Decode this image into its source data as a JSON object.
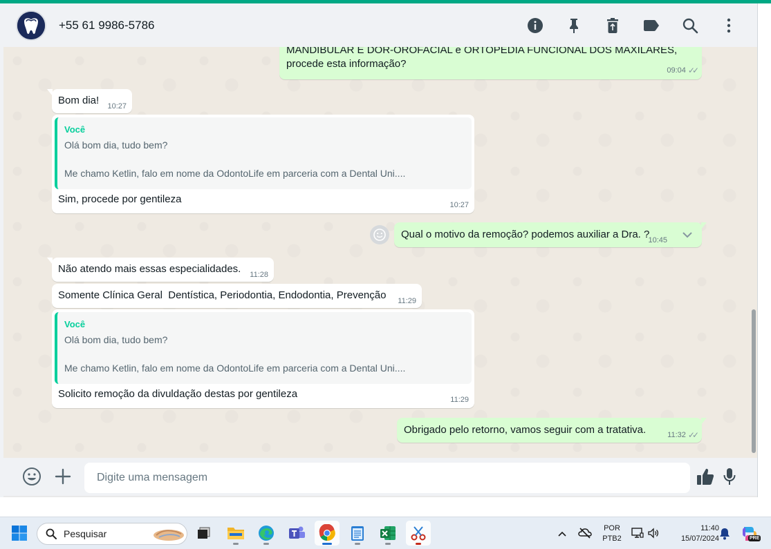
{
  "header": {
    "contact_name": "+55 61 9986-5786",
    "icons": [
      "info-icon",
      "pin-icon",
      "delete-icon",
      "label-icon",
      "search-icon",
      "menu-icon"
    ]
  },
  "messages": [
    {
      "direction": "out",
      "text_line1": "MANDIBULAR E DOR-OROFACIAL e ORTOPEDIA FUNCIONAL DOS MAXILARES,",
      "text_line2": "procede esta informação?",
      "time": "09:04",
      "status": "read"
    },
    {
      "direction": "in",
      "text": "Bom dia!",
      "time": "10:27"
    },
    {
      "direction": "in",
      "quote_author": "Você",
      "quote_line1": "Olá bom dia, tudo bem?",
      "quote_line2": "Me chamo Ketlin, falo em nome da OdontoLife em parceria com a Dental Uni....",
      "text": "Sim, procede por gentileza",
      "time": "10:27"
    },
    {
      "direction": "out",
      "text": "Qual o motivo da remoção? podemos auxiliar a Dra. ?",
      "time": "10:45",
      "status": "read"
    },
    {
      "direction": "in",
      "text": "Não atendo mais essas especialidades.",
      "time": "11:28"
    },
    {
      "direction": "in",
      "text": "Somente Clínica Geral  Dentística, Periodontia, Endodontia, Prevenção",
      "time": "11:29"
    },
    {
      "direction": "in",
      "quote_author": "Você",
      "quote_line1": "Olá bom dia, tudo bem?",
      "quote_line2": "Me chamo Ketlin, falo em nome da OdontoLife em parceria com a Dental Uni....",
      "text": "Solicito remoção da divuldação destas por gentileza",
      "time": "11:29"
    },
    {
      "direction": "out",
      "text": "Obrigado pelo retorno, vamos seguir com a tratativa.",
      "time": "11:32",
      "status": "read"
    }
  ],
  "composer": {
    "placeholder": "Digite uma mensagem"
  },
  "taskbar": {
    "search_label": "Pesquisar",
    "language_line1": "POR",
    "language_line2": "PTB2",
    "time": "11:40",
    "date": "15/07/2024",
    "copilot_badge": "PRE"
  },
  "colors": {
    "accent": "#00a884",
    "outgoing_bubble": "#d9fdd3",
    "incoming_bubble": "#ffffff",
    "quote_bar": "#06cf9c",
    "chat_background": "#efeae2"
  }
}
